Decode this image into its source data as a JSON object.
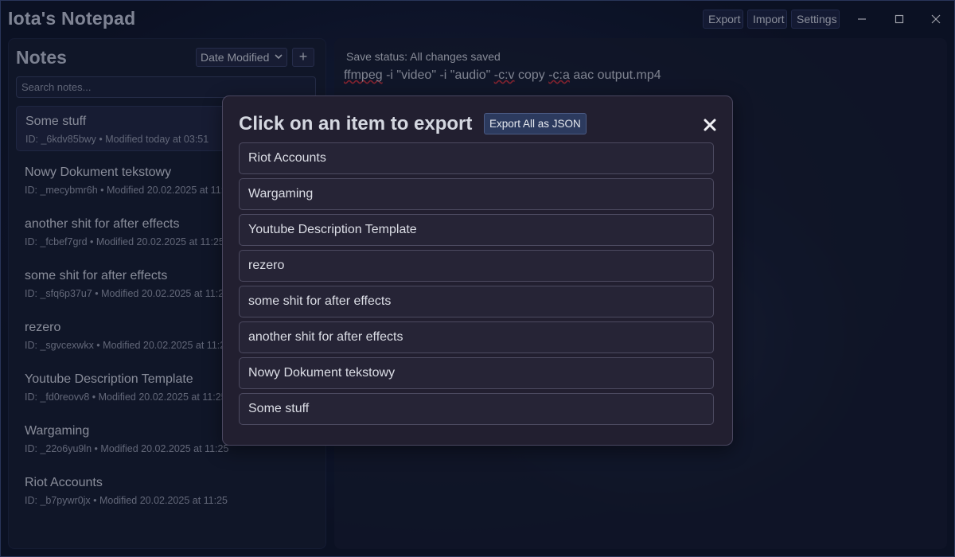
{
  "window": {
    "title": "Iota's Notepad",
    "menu": {
      "export": "Export",
      "import": "Import",
      "settings": "Settings"
    }
  },
  "sidebar": {
    "title": "Notes",
    "sort": "Date Modified",
    "add_label": "+",
    "search_placeholder": "Search notes...",
    "notes": [
      {
        "title": "Some stuff",
        "meta": "ID: _6kdv85bwy • Modified today at 03:51",
        "selected": true
      },
      {
        "title": "Nowy Dokument tekstowy",
        "meta": "ID: _mecybmr6h • Modified 20.02.2025 at 11:25"
      },
      {
        "title": "another shit for after effects",
        "meta": "ID: _fcbef7grd • Modified 20.02.2025 at 11:25"
      },
      {
        "title": "some shit for after effects",
        "meta": "ID: _sfq6p37u7 • Modified 20.02.2025 at 11:25"
      },
      {
        "title": "rezero",
        "meta": "ID: _sgvcexwkx • Modified 20.02.2025 at 11:25"
      },
      {
        "title": "Youtube Description Template",
        "meta": "ID: _fd0reovv8 • Modified 20.02.2025 at 11:25"
      },
      {
        "title": "Wargaming",
        "meta": "ID: _22o6yu9ln • Modified 20.02.2025 at 11:25"
      },
      {
        "title": "Riot Accounts",
        "meta": "ID: _b7pywr0jx • Modified 20.02.2025 at 11:25"
      }
    ]
  },
  "editor": {
    "save_status": "Save status: All changes saved",
    "content": {
      "w1": "ffmpeg",
      "w2": " -i \"video\" -i \"audio\" ",
      "w3": "-c:v",
      "w4": " copy ",
      "w5": "-c:a",
      "w6": " aac output.mp4"
    }
  },
  "export_dialog": {
    "title": "Click on an item to export",
    "export_all": "Export All as JSON",
    "items": [
      "Riot Accounts",
      "Wargaming",
      "Youtube Description Template",
      "rezero",
      "some shit for after effects",
      "another shit for after effects",
      "Nowy Dokument tekstowy",
      "Some stuff"
    ]
  }
}
